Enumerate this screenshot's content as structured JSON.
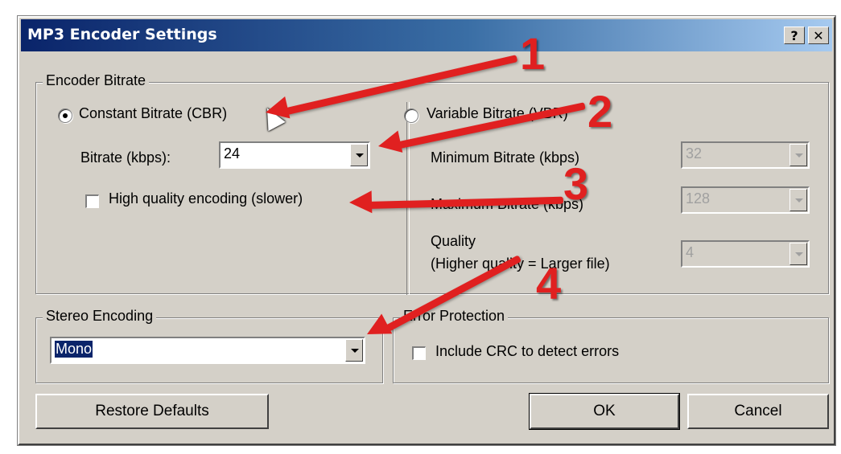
{
  "window": {
    "title": "MP3 Encoder Settings",
    "help_button": "?",
    "close_button": "✕"
  },
  "encoder_bitrate": {
    "legend": "Encoder Bitrate",
    "cbr": {
      "label": "Constant Bitrate (CBR)",
      "selected": true,
      "bitrate_label": "Bitrate (kbps):",
      "bitrate_value": "24",
      "high_quality_label": "High quality encoding (slower)",
      "high_quality_checked": false
    },
    "vbr": {
      "label": "Variable Bitrate (VBR)",
      "selected": false,
      "min_label": "Minimum Bitrate (kbps)",
      "min_value": "32",
      "max_label": "Maximum Bitrate (kbps)",
      "max_value": "128",
      "quality_label_line1": "Quality",
      "quality_label_line2": "(Higher quality = Larger file)",
      "quality_value": "4"
    }
  },
  "stereo_encoding": {
    "legend": "Stereo Encoding",
    "value": "Mono"
  },
  "error_protection": {
    "legend": "Error Protection",
    "crc_label": "Include CRC to detect errors",
    "crc_checked": false
  },
  "buttons": {
    "restore_defaults": "Restore Defaults",
    "ok": "OK",
    "cancel": "Cancel"
  },
  "annotations": [
    "1",
    "2",
    "3",
    "4"
  ],
  "colors": {
    "title_bar_start": "#0a246a",
    "title_bar_end": "#a6caf0",
    "dialog_face": "#d4d0c8",
    "annotation_red": "#e02020"
  }
}
